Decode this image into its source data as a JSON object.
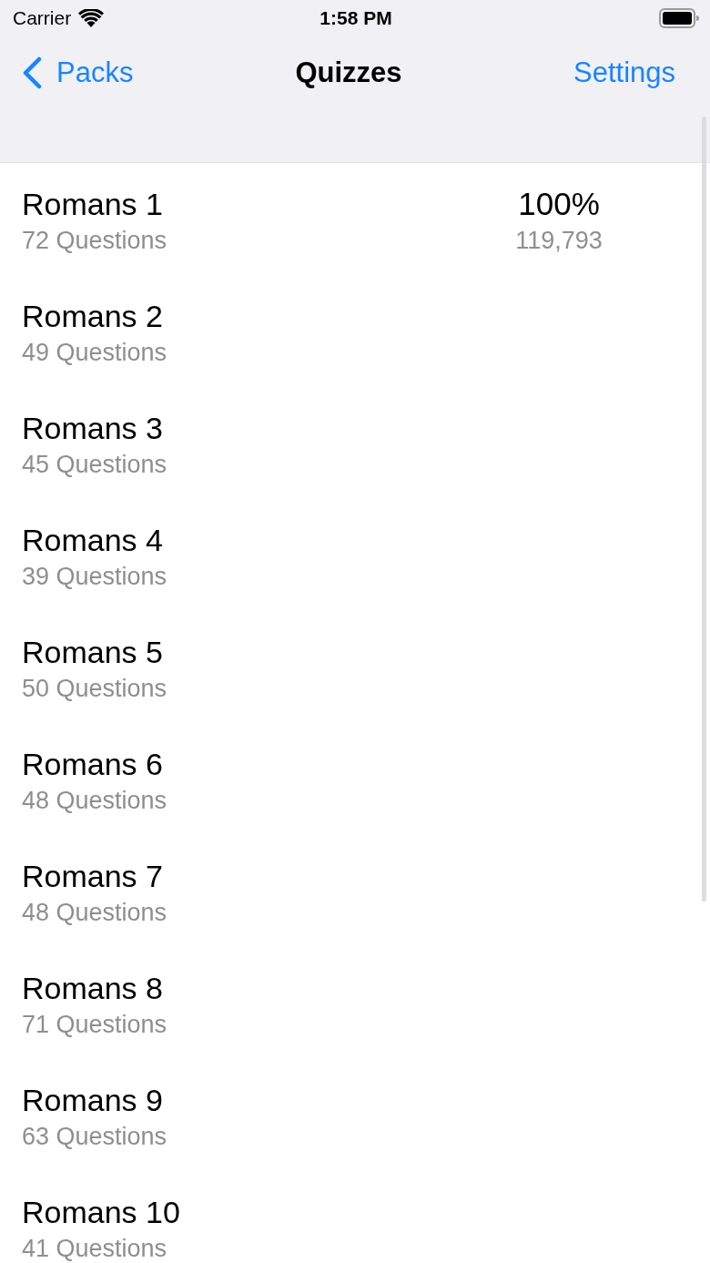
{
  "status_bar": {
    "carrier": "Carrier",
    "time": "1:58 PM"
  },
  "nav_bar": {
    "back_label": "Packs",
    "title": "Quizzes",
    "right_button": "Settings"
  },
  "quizzes": [
    {
      "title": "Romans 1",
      "subtitle": "72 Questions",
      "score": "100%",
      "plays": "119,793"
    },
    {
      "title": "Romans 2",
      "subtitle": "49 Questions"
    },
    {
      "title": "Romans 3",
      "subtitle": "45 Questions"
    },
    {
      "title": "Romans 4",
      "subtitle": "39 Questions"
    },
    {
      "title": "Romans 5",
      "subtitle": "50 Questions"
    },
    {
      "title": "Romans 6",
      "subtitle": "48 Questions"
    },
    {
      "title": "Romans 7",
      "subtitle": "48 Questions"
    },
    {
      "title": "Romans 8",
      "subtitle": "71 Questions"
    },
    {
      "title": "Romans 9",
      "subtitle": "63 Questions"
    },
    {
      "title": "Romans 10",
      "subtitle": "41 Questions"
    }
  ]
}
